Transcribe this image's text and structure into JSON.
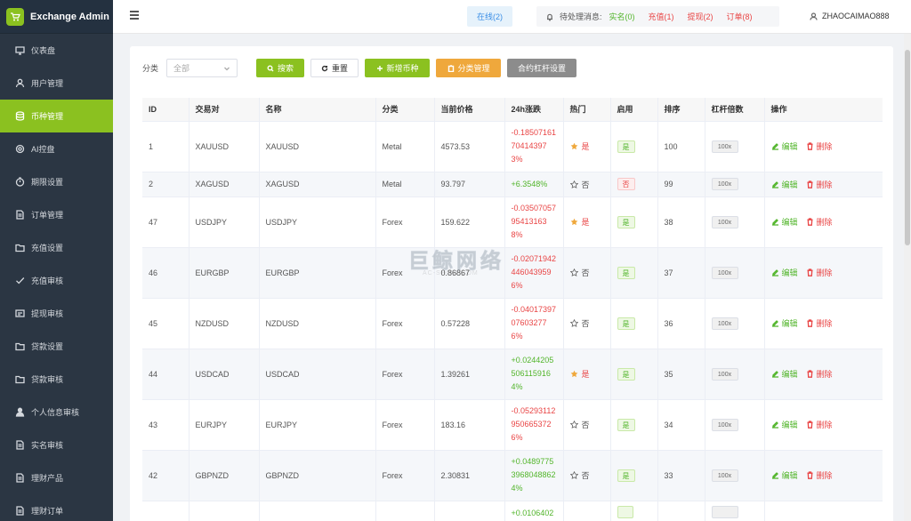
{
  "app": {
    "title": "Exchange Admin",
    "brand_color": "#8bc120",
    "sidebar_color": "#2b3643"
  },
  "sidebar": {
    "items": [
      {
        "label": "仪表盘",
        "icon": "dashboard-icon",
        "active": false
      },
      {
        "label": "用户管理",
        "icon": "user-icon",
        "active": false
      },
      {
        "label": "币种管理",
        "icon": "database-icon",
        "active": true
      },
      {
        "label": "AI控盘",
        "icon": "gear-icon",
        "active": false
      },
      {
        "label": "期限设置",
        "icon": "timer-icon",
        "active": false
      },
      {
        "label": "订单管理",
        "icon": "document-icon",
        "active": false
      },
      {
        "label": "充值设置",
        "icon": "folder-icon",
        "active": false
      },
      {
        "label": "充值审核",
        "icon": "check-icon",
        "active": false
      },
      {
        "label": "提现审核",
        "icon": "card-icon",
        "active": false
      },
      {
        "label": "贷款设置",
        "icon": "folder-icon",
        "active": false
      },
      {
        "label": "贷款审核",
        "icon": "folder-icon",
        "active": false
      },
      {
        "label": "个人信息审核",
        "icon": "person-icon",
        "active": false
      },
      {
        "label": "实名审核",
        "icon": "document-icon",
        "active": false
      },
      {
        "label": "理财产品",
        "icon": "document-icon",
        "active": false
      },
      {
        "label": "理财订单",
        "icon": "document-icon",
        "active": false
      }
    ]
  },
  "header": {
    "online": "在线(2)",
    "pending_label": "待处理消息:",
    "pending": {
      "realname": "实名(0)",
      "recharge": "充值(1)",
      "withdraw": "提现(2)",
      "orders": "订单(8)"
    },
    "username": "ZHAOCAIMAO888"
  },
  "toolbar": {
    "filter_label": "分类",
    "select_value": "全部",
    "search": "搜索",
    "reset": "重置",
    "add": "新增币种",
    "category": "分类管理",
    "leverage": "合约杠杆设置"
  },
  "table": {
    "headers": [
      "ID",
      "交易对",
      "名称",
      "分类",
      "当前价格",
      "24h涨跌",
      "热门",
      "启用",
      "排序",
      "杠杆倍数",
      "操作"
    ],
    "rows": [
      {
        "id": "1",
        "pair": "XAUUSD",
        "name": "XAUUSD",
        "cat": "Metal",
        "price": "4573.53",
        "change": "-0.18507161704143973%",
        "dir": "down",
        "hot": "是",
        "hot_on": true,
        "enabled": "是",
        "enabled_on": true,
        "sort": "100",
        "lev": "100x"
      },
      {
        "id": "2",
        "pair": "XAGUSD",
        "name": "XAGUSD",
        "cat": "Metal",
        "price": "93.797",
        "change": "+6.3548%",
        "dir": "up",
        "hot": "否",
        "hot_on": false,
        "enabled": "否",
        "enabled_on": false,
        "sort": "99",
        "lev": "100x"
      },
      {
        "id": "47",
        "pair": "USDJPY",
        "name": "USDJPY",
        "cat": "Forex",
        "price": "159.622",
        "change": "-0.03507057954131638%",
        "dir": "down",
        "hot": "是",
        "hot_on": true,
        "enabled": "是",
        "enabled_on": true,
        "sort": "38",
        "lev": "100x"
      },
      {
        "id": "46",
        "pair": "EURGBP",
        "name": "EURGBP",
        "cat": "Forex",
        "price": "0.86867",
        "change": "-0.020719424460439596%",
        "dir": "down",
        "hot": "否",
        "hot_on": false,
        "enabled": "是",
        "enabled_on": true,
        "sort": "37",
        "lev": "100x"
      },
      {
        "id": "45",
        "pair": "NZDUSD",
        "name": "NZDUSD",
        "cat": "Forex",
        "price": "0.57228",
        "change": "-0.04017397076032776%",
        "dir": "down",
        "hot": "否",
        "hot_on": false,
        "enabled": "是",
        "enabled_on": true,
        "sort": "36",
        "lev": "100x"
      },
      {
        "id": "44",
        "pair": "USDCAD",
        "name": "USDCAD",
        "cat": "Forex",
        "price": "1.39261",
        "change": "+0.02442055061159164%",
        "dir": "up",
        "hot": "是",
        "hot_on": true,
        "enabled": "是",
        "enabled_on": true,
        "sort": "35",
        "lev": "100x"
      },
      {
        "id": "43",
        "pair": "EURJPY",
        "name": "EURJPY",
        "cat": "Forex",
        "price": "183.16",
        "change": "-0.052931129506653726%",
        "dir": "down",
        "hot": "否",
        "hot_on": false,
        "enabled": "是",
        "enabled_on": true,
        "sort": "34",
        "lev": "100x"
      },
      {
        "id": "42",
        "pair": "GBPNZD",
        "name": "GBPNZD",
        "cat": "Forex",
        "price": "2.30831",
        "change": "+0.04897753968048862 4%",
        "dir": "up",
        "hot": "否",
        "hot_on": false,
        "enabled": "是",
        "enabled_on": true,
        "sort": "33",
        "lev": "100x"
      },
      {
        "id": "",
        "pair": "",
        "name": "",
        "cat": "",
        "price": "",
        "change": "+0.0106402",
        "dir": "up",
        "hot": "",
        "hot_on": false,
        "enabled": "",
        "enabled_on": true,
        "sort": "",
        "lev": ""
      }
    ],
    "edit_label": "编辑",
    "delete_label": "删除"
  },
  "watermark": {
    "main": "巨鲸网络",
    "sub": "AC-SHOW.COM"
  }
}
